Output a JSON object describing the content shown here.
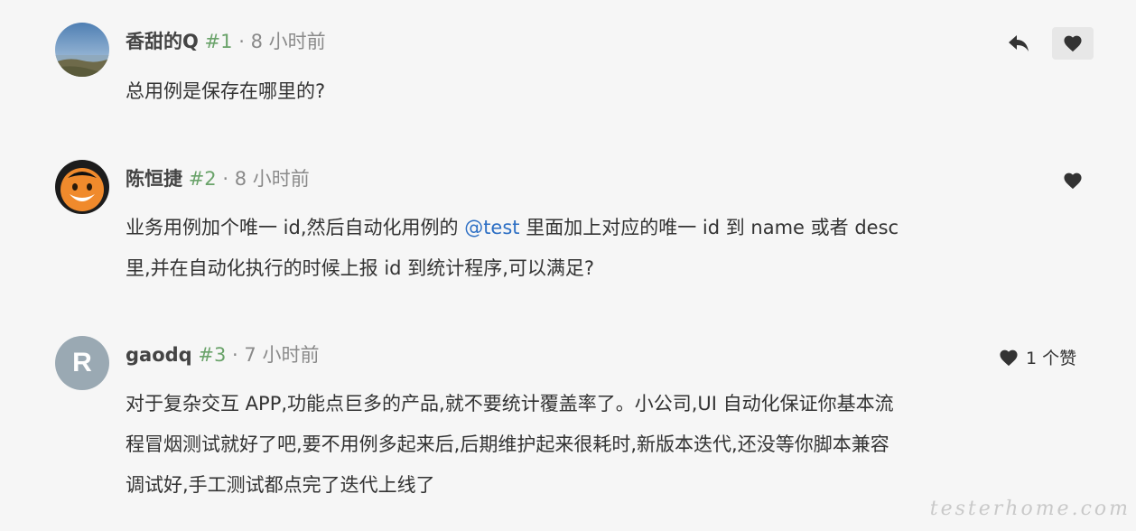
{
  "comments": [
    {
      "author": "香甜的Q",
      "floor": "#1",
      "separator": "·",
      "time": "8 小时前",
      "body": "总用例是保存在哪里的?",
      "actions": {
        "reply_icon": "reply-icon",
        "like_icon": "heart-icon"
      }
    },
    {
      "author": "陈恒捷",
      "floor": "#2",
      "separator": "·",
      "time": "8 小时前",
      "body_line1_pre": "业务用例加个唯一 id,然后自动化用例的 ",
      "mention": "@test",
      "body_line1_post": " 里面加上对应的唯一 id 到 name 或者 desc",
      "body_line2": "里,并在自动化执行的时候上报 id 到统计程序,可以满足?",
      "actions": {
        "like_icon": "heart-icon"
      }
    },
    {
      "author": "gaodq",
      "avatar_letter": "R",
      "floor": "#3",
      "separator": "·",
      "time": "7 小时前",
      "likes_text": "1 个赞",
      "body_line1": "对于复杂交互 APP,功能点巨多的产品,就不要统计覆盖率了。小公司,UI 自动化保证你基本流",
      "body_line2": "程冒烟测试就好了吧,要不用例多起来后,后期维护起来很耗时,新版本迭代,还没等你脚本兼容",
      "body_line3": "调试好,手工测试都点完了迭代上线了"
    }
  ],
  "watermark": "testerhome.com",
  "colors": {
    "floor": "#6aa36a",
    "mention": "#2d6fc4",
    "time": "#8a8a8a"
  }
}
